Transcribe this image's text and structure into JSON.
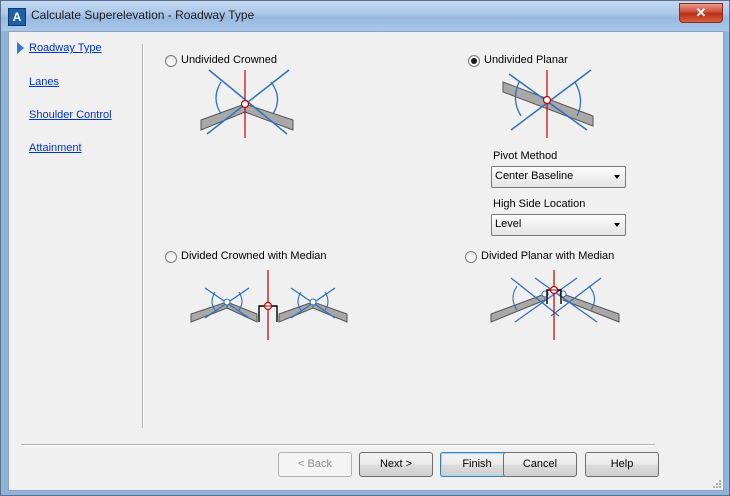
{
  "window": {
    "title": "Calculate Superelevation - Roadway Type",
    "close_label": "✕",
    "app_icon_letter": "A"
  },
  "nav": {
    "items": [
      {
        "label": "Roadway Type",
        "active": true
      },
      {
        "label": "Lanes",
        "active": false
      },
      {
        "label": "Shoulder Control",
        "active": false
      },
      {
        "label": "Attainment",
        "active": false
      }
    ]
  },
  "options": {
    "undivided_crowned": {
      "label": "Undivided Crowned",
      "selected": false
    },
    "undivided_planar": {
      "label": "Undivided Planar",
      "selected": true
    },
    "divided_crowned_median": {
      "label": "Divided Crowned with Median",
      "selected": false
    },
    "divided_planar_median": {
      "label": "Divided Planar with Median",
      "selected": false
    }
  },
  "pivot_method": {
    "label": "Pivot Method",
    "value": "Center Baseline"
  },
  "high_side_location": {
    "label": "High Side Location",
    "value": "Level"
  },
  "buttons": {
    "back": "< Back",
    "next": "Next >",
    "finish": "Finish",
    "cancel": "Cancel",
    "help": "Help"
  },
  "colors": {
    "link": "#0033cc",
    "diagram_blue": "#2f6fc0",
    "pivot_red": "#c00000",
    "pavement_gray": "#a8a8a8"
  }
}
